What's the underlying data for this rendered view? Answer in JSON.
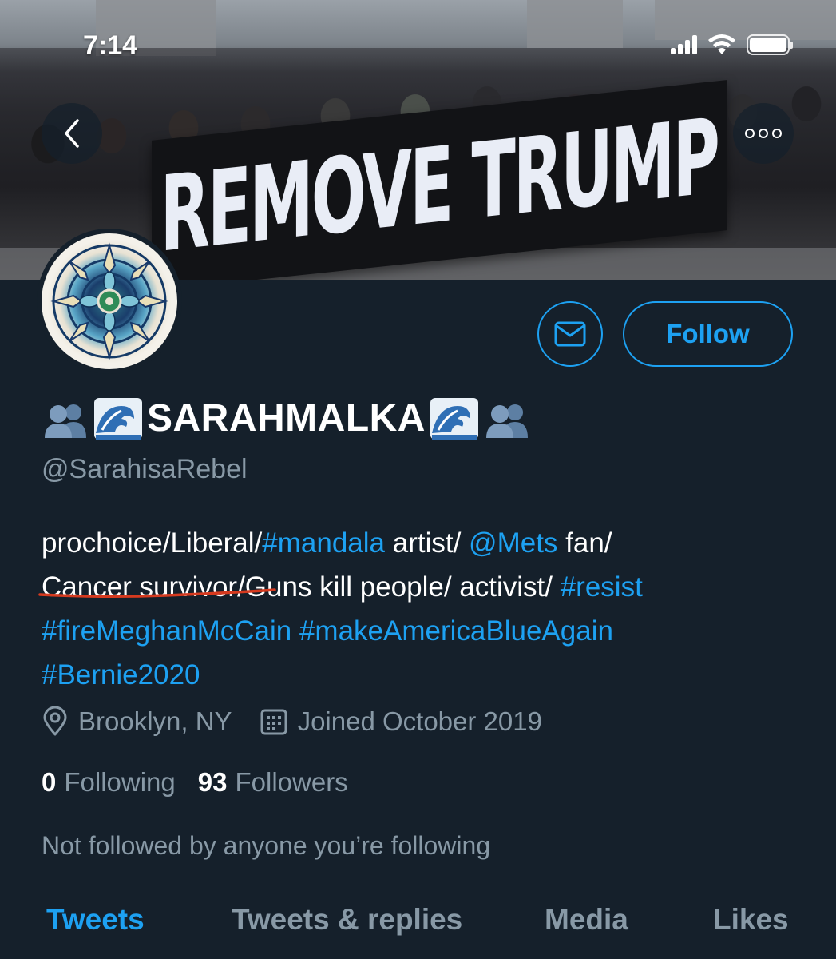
{
  "status_bar": {
    "time": "7:14"
  },
  "banner": {
    "sign_text": "REMOVE TRUMP"
  },
  "profile": {
    "display_name": "SARAHMALKA",
    "handle": "@SarahisaRebel",
    "follow_label": "Follow",
    "bio": {
      "line1_a": "prochoice/Liberal/",
      "line1_tag1": "#mandala",
      "line1_b": " artist/ ",
      "line1_tag2": "@Mets",
      "line1_c": " fan/",
      "line2_a": "Cancer survivor",
      "line2_b": "/Guns kill people/ activist/ ",
      "line2_tag": "#resist",
      "line3_tag1": "#fireMeghanMcCain",
      "line3_tag2": "#makeAmericaBlueAgain",
      "line4_tag": "#Bernie2020"
    },
    "location": "Brooklyn, NY",
    "joined": "Joined October 2019",
    "following_count": "0",
    "following_label": "Following",
    "followers_count": "93",
    "followers_label": "Followers",
    "not_followed_text": "Not followed by anyone you’re following"
  },
  "tabs": [
    {
      "label": "Tweets",
      "active": true
    },
    {
      "label": "Tweets & replies",
      "active": false
    },
    {
      "label": "Media",
      "active": false
    },
    {
      "label": "Likes",
      "active": false
    }
  ],
  "colors": {
    "background": "#15202b",
    "accent": "#1da1f2",
    "secondary_text": "#8899a6",
    "annotation_underline": "#d63a1f"
  },
  "icons": [
    "back-arrow-icon",
    "more-dots-icon",
    "mail-icon",
    "location-pin-icon",
    "calendar-icon",
    "busts-in-silhouette-emoji",
    "water-wave-emoji",
    "cellular-signal-icon",
    "wifi-icon",
    "battery-icon"
  ]
}
